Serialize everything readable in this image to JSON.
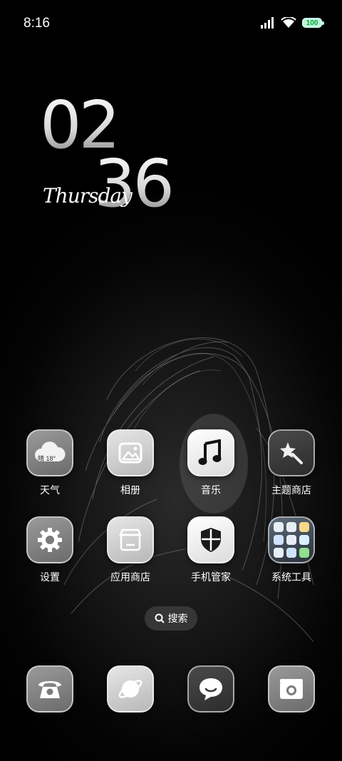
{
  "status_bar": {
    "time": "8:16",
    "battery": "100",
    "icons": [
      "signal-icon",
      "wifi-icon",
      "battery-icon"
    ]
  },
  "clock": {
    "hour": "02",
    "minute": "36",
    "day": "Thursday"
  },
  "apps": [
    {
      "label": "天气",
      "icon": "weather-icon",
      "temp": "晴 18°"
    },
    {
      "label": "相册",
      "icon": "gallery-icon"
    },
    {
      "label": "音乐",
      "icon": "music-icon"
    },
    {
      "label": "主题商店",
      "icon": "theme-store-icon"
    },
    {
      "label": "设置",
      "icon": "gear-icon"
    },
    {
      "label": "应用商店",
      "icon": "app-store-icon"
    },
    {
      "label": "手机管家",
      "icon": "shield-icon"
    },
    {
      "label": "系统工具",
      "icon": "folder-icon"
    }
  ],
  "search": {
    "label": "搜索",
    "icon": "search-icon"
  },
  "dock": [
    {
      "icon": "phone-icon"
    },
    {
      "icon": "browser-icon"
    },
    {
      "icon": "messages-icon"
    },
    {
      "icon": "camera-icon"
    }
  ]
}
